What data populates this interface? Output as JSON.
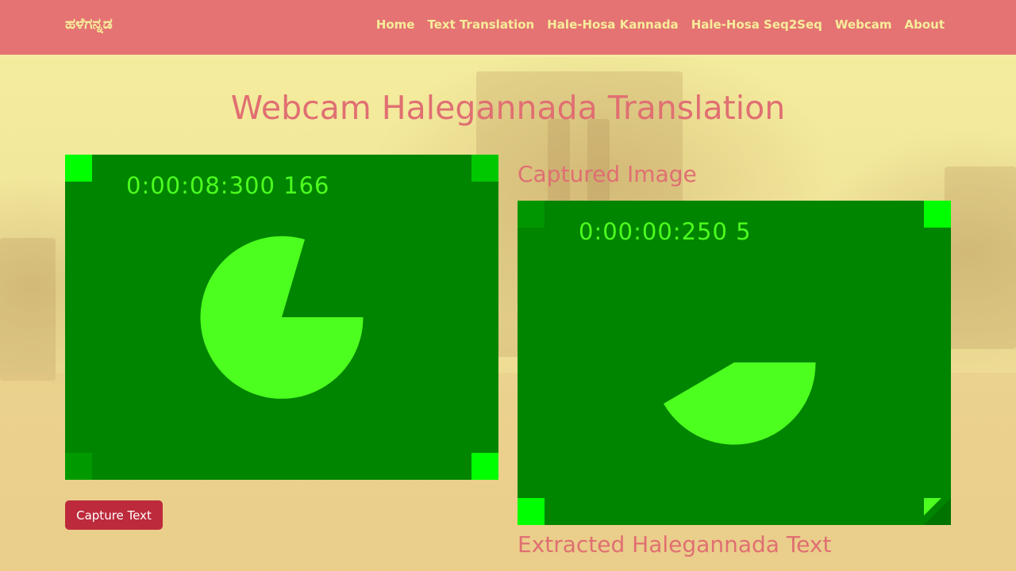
{
  "nav": {
    "brand": "ಹಳೆಗನ್ನಡ",
    "links": [
      "Home",
      "Text Translation",
      "Hale-Hosa Kannada",
      "Hale-Hosa Seq2Seq",
      "Webcam",
      "About"
    ]
  },
  "page": {
    "title": "Webcam Halegannada Translation"
  },
  "live_feed": {
    "timestamp": "0:00:08:300 166"
  },
  "captured": {
    "heading": "Captured Image",
    "timestamp": "0:00:00:250 5"
  },
  "extracted": {
    "heading": "Extracted Halegannada Text"
  },
  "actions": {
    "capture_label": "Capture Text"
  },
  "colors": {
    "navbar": "#e57373",
    "nav_text": "#f6ec9a",
    "heading": "#e06f72",
    "video_bg": "#008500",
    "video_fg": "#4cff1f",
    "button": "#bd2a3c"
  }
}
